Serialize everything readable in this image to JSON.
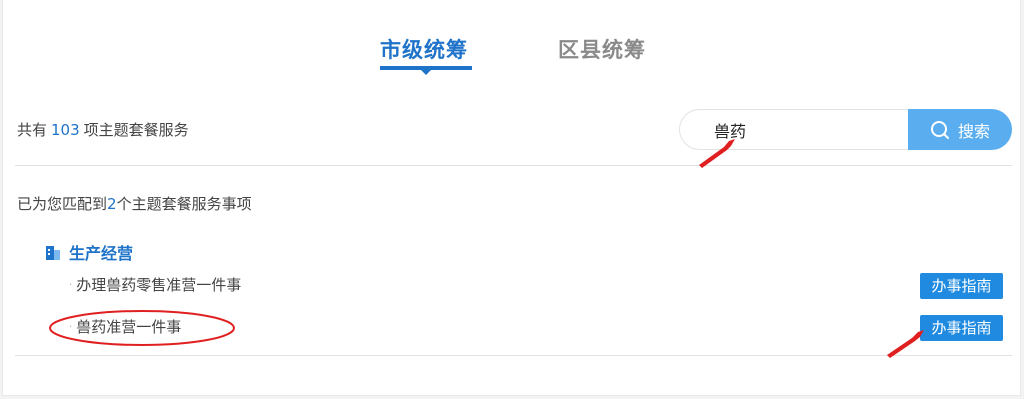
{
  "tabs": [
    {
      "label": "市级统筹",
      "active": true
    },
    {
      "label": "区县统筹",
      "active": false
    }
  ],
  "summary": {
    "prefix": "共有",
    "count": "103",
    "suffix": "项主题套餐服务"
  },
  "search": {
    "value": "兽药",
    "button_label": "搜索",
    "button_icon": "search-icon"
  },
  "match": {
    "prefix": "已为您匹配到",
    "count": "2",
    "suffix": "个主题套餐服务事项"
  },
  "category": {
    "title": "生产经营",
    "icon": "building-icon",
    "items": [
      {
        "label": "办理兽药零售准营一件事",
        "action_label": "办事指南"
      },
      {
        "label": "兽药准营一件事",
        "action_label": "办事指南"
      }
    ]
  },
  "colors": {
    "accent": "#1f73c8",
    "search_button": "#5aaef0",
    "guide_button": "#1f8ae0",
    "annotation": "#e02020"
  }
}
